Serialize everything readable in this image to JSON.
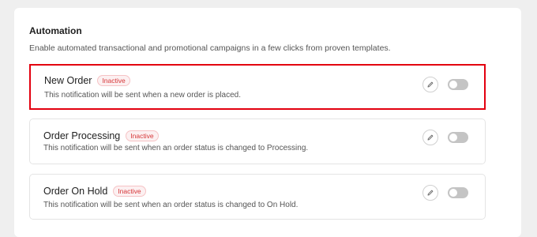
{
  "automation": {
    "title": "Automation",
    "description": "Enable automated transactional and promotional campaigns in a few clicks from proven templates."
  },
  "notifications": [
    {
      "title": "New Order",
      "status": "Inactive",
      "description": "This notification will be sent when a new order is placed.",
      "enabled": false,
      "highlighted": true
    },
    {
      "title": "Order Processing",
      "status": "Inactive",
      "description": "This notification will be sent when an order status is changed to Processing.",
      "enabled": false,
      "highlighted": false
    },
    {
      "title": "Order On Hold",
      "status": "Inactive",
      "description": "This notification will be sent when an order status is changed to On Hold.",
      "enabled": false,
      "highlighted": false
    }
  ],
  "colors": {
    "badge_text": "#d63638",
    "highlight_border": "#e3000f",
    "toggle_off": "#c4c4c4"
  },
  "icons": {
    "edit": "pencil-icon"
  }
}
